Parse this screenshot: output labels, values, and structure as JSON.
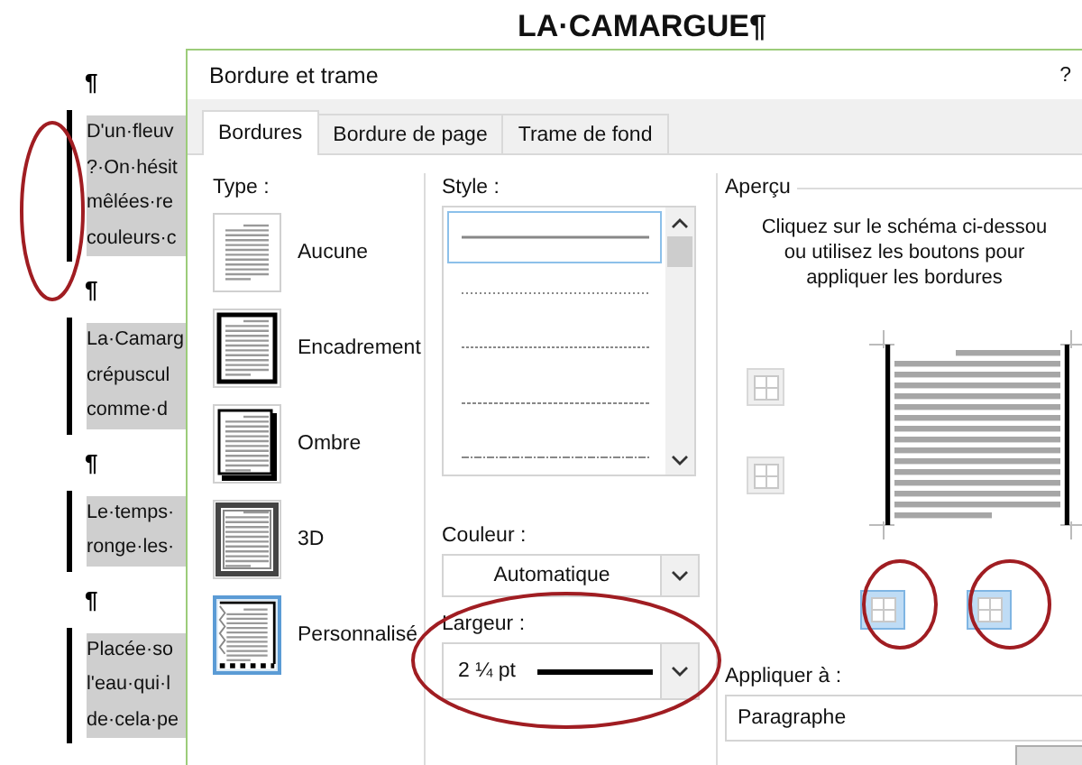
{
  "document": {
    "title": "LA·CAMARGUE¶",
    "blocks": [
      {
        "kind": "pilcrow",
        "text": "¶"
      },
      {
        "kind": "paragraph",
        "bordered": true,
        "lines": [
          "D'un·fleuv",
          "?·On·hésit",
          "mêlées·re",
          "couleurs·c"
        ]
      },
      {
        "kind": "pilcrow",
        "text": "¶"
      },
      {
        "kind": "paragraph",
        "bordered": true,
        "lines": [
          "La·Camarg",
          "crépuscul",
          "comme·d"
        ]
      },
      {
        "kind": "pilcrow",
        "text": "¶"
      },
      {
        "kind": "paragraph",
        "bordered": true,
        "lines": [
          "Le·temps·",
          "ronge·les·"
        ]
      },
      {
        "kind": "pilcrow",
        "text": "¶"
      },
      {
        "kind": "paragraph",
        "bordered": true,
        "lines": [
          "Placée·so",
          "l'eau·qui·l",
          "de·cela·pe"
        ]
      }
    ]
  },
  "dialog": {
    "title": "Bordure et trame",
    "help": "?",
    "tabs": [
      {
        "label": "Bordures",
        "selected": true
      },
      {
        "label": "Bordure de page",
        "selected": false
      },
      {
        "label": "Trame de fond",
        "selected": false
      }
    ],
    "type": {
      "label": "Type :",
      "items": [
        {
          "kind": "none",
          "label": "Aucune",
          "selected": false
        },
        {
          "kind": "box",
          "label": "Encadrement",
          "selected": false
        },
        {
          "kind": "shadow",
          "label": "Ombre",
          "selected": false
        },
        {
          "kind": "relief",
          "label": "3D",
          "selected": false
        },
        {
          "kind": "custom",
          "label": "Personnalisé",
          "selected": true
        }
      ]
    },
    "style": {
      "label": "Style :",
      "items": [
        {
          "kind": "solid",
          "selected": true
        },
        {
          "kind": "dotted",
          "selected": false
        },
        {
          "kind": "dotted-dense",
          "selected": false
        },
        {
          "kind": "dashed-fine",
          "selected": false
        },
        {
          "kind": "dash-dot",
          "selected": false
        }
      ]
    },
    "color": {
      "label": "Couleur :",
      "value": "Automatique"
    },
    "width": {
      "label": "Largeur :",
      "value": "2 ¼ pt"
    },
    "preview": {
      "label": "Aperçu",
      "instructions": [
        "Cliquez sur le schéma ci-dessou",
        "ou utilisez les boutons pour",
        "appliquer les bordures"
      ],
      "border_buttons": [
        {
          "on": false
        },
        {
          "on": false
        },
        {
          "on": true
        },
        {
          "on": true
        }
      ]
    },
    "apply_to": {
      "label": "Appliquer à :",
      "value": "Paragraphe"
    }
  }
}
